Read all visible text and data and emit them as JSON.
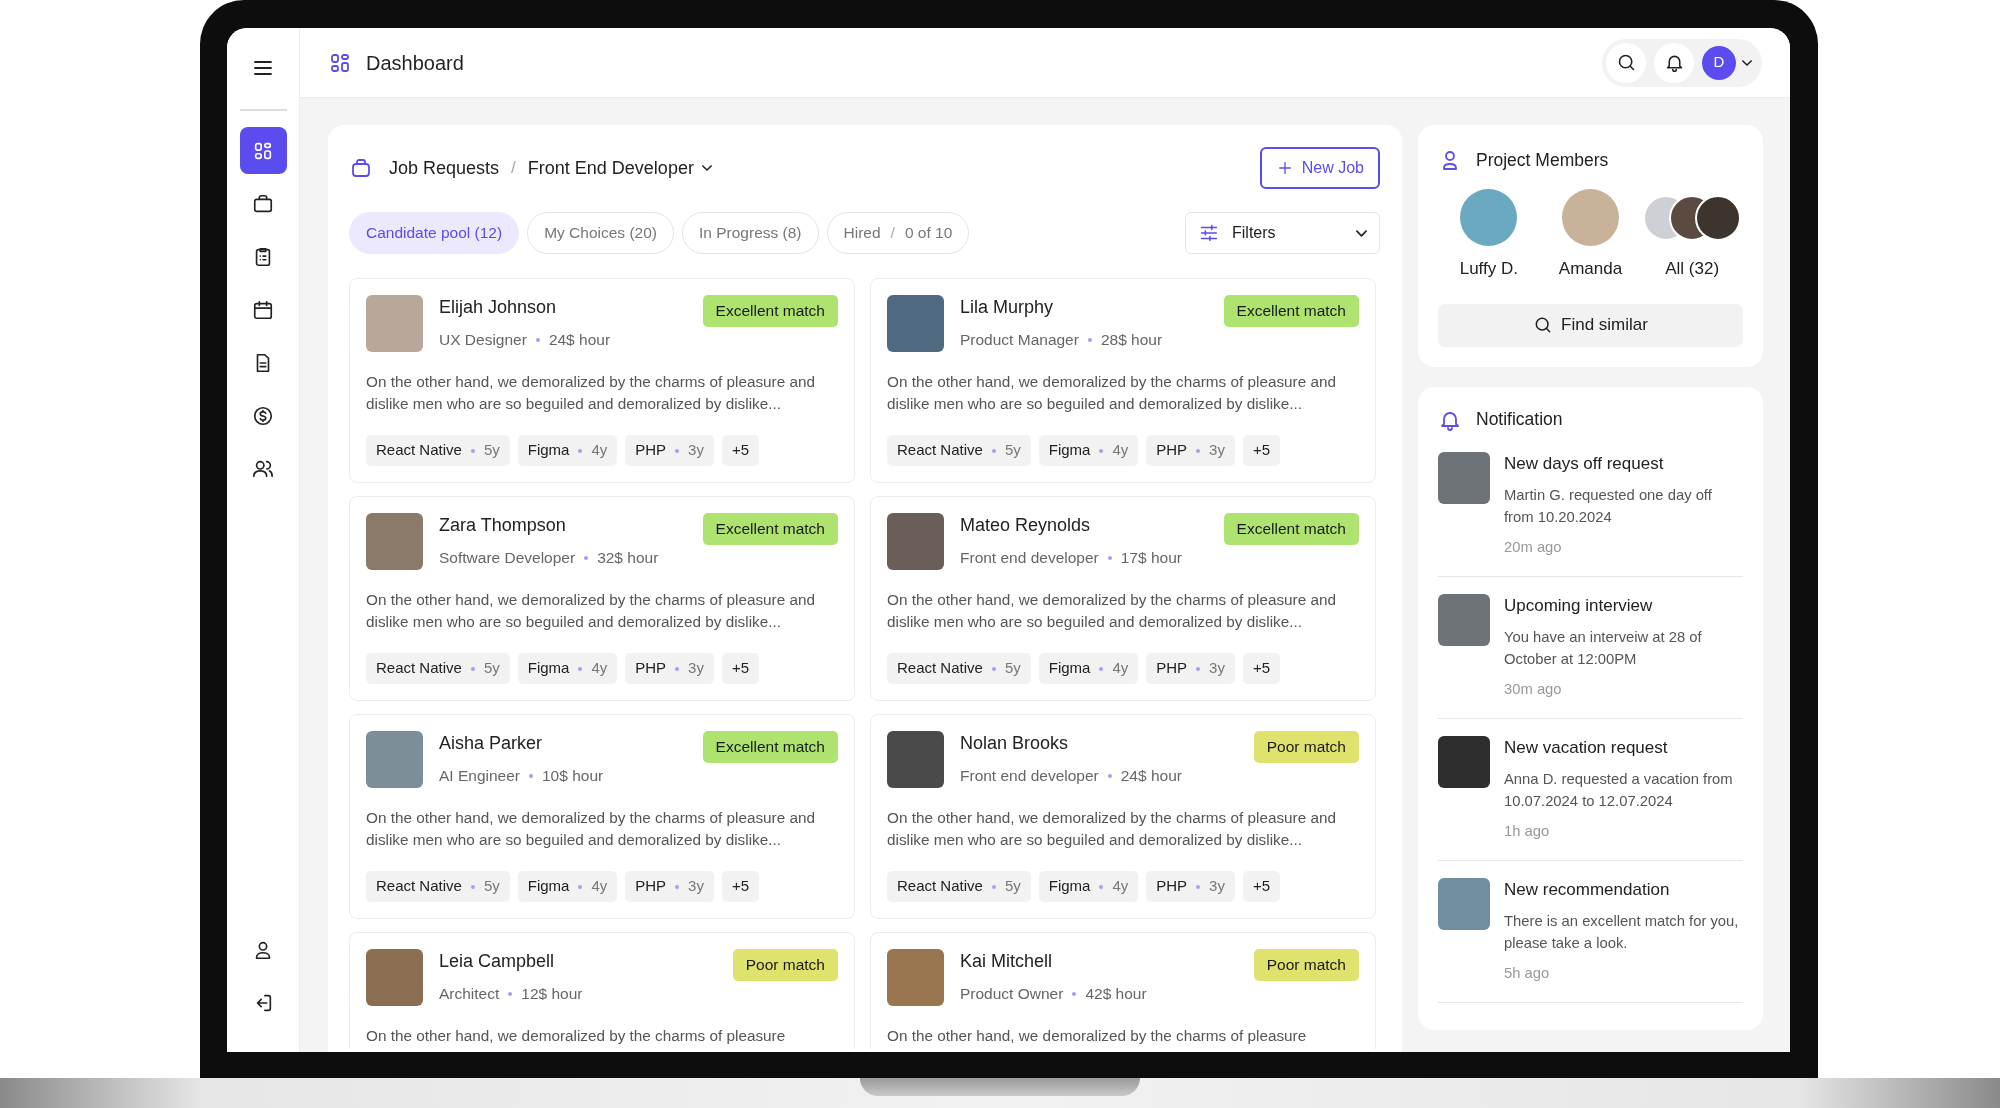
{
  "sidebar": {
    "items": [
      {
        "kind": "grid",
        "selected": true
      },
      {
        "kind": "briefcase",
        "selected": false
      },
      {
        "kind": "clipboard",
        "selected": false
      },
      {
        "kind": "calendar",
        "selected": false
      },
      {
        "kind": "document",
        "selected": false
      },
      {
        "kind": "dollar",
        "selected": false
      },
      {
        "kind": "users",
        "selected": false
      }
    ],
    "bottom_items": [
      {
        "kind": "user",
        "selected": false
      },
      {
        "kind": "logout",
        "selected": false
      }
    ]
  },
  "topbar": {
    "title": "Dashboard",
    "avatar_initial": "D"
  },
  "breadcrumb": {
    "items": [
      "Job Requests",
      "Front End Developer"
    ],
    "separator": "/"
  },
  "new_job_button": "New Job",
  "tabs": [
    {
      "label": "Candidate pool (12)",
      "selected": true
    },
    {
      "label": "My Choices (20)",
      "selected": false
    },
    {
      "label": "In Progress (8)",
      "selected": false
    },
    {
      "label": "Hired",
      "separator": "/",
      "count": "0 of 10",
      "selected": false
    }
  ],
  "filters": {
    "label": "Filters"
  },
  "candidates": [
    {
      "name": "Elijah Johnson",
      "role": "UX Designer",
      "rate": "24$ hour",
      "match": "Excellent match",
      "color": "#aee36f",
      "description": "On the other hand, we demoralized by the charms of pleasure and dislike men who are so beguiled and demoralized by  dislike...",
      "skills": [
        {
          "name": "React Native",
          "years": "5y"
        },
        {
          "name": "Figma",
          "years": "4y"
        },
        {
          "name": "PHP",
          "years": "3y"
        }
      ],
      "more": "+5"
    },
    {
      "name": "Lila Murphy",
      "role": "Product Manager",
      "rate": "28$ hour",
      "match": "Excellent match",
      "color": "#aee36f",
      "description": "On the other hand, we demoralized by the charms of pleasure and dislike men who are so beguiled and demoralized by  dislike...",
      "skills": [
        {
          "name": "React Native",
          "years": "5y"
        },
        {
          "name": "Figma",
          "years": "4y"
        },
        {
          "name": "PHP",
          "years": "3y"
        }
      ],
      "more": "+5"
    },
    {
      "name": "Zara Thompson",
      "role": "Software Developer",
      "rate": "32$ hour",
      "match": "Excellent match",
      "color": "#aee36f",
      "description": "On the other hand, we demoralized by the charms of pleasure and dislike men who are so beguiled and demoralized by  dislike...",
      "skills": [
        {
          "name": "React Native",
          "years": "5y"
        },
        {
          "name": "Figma",
          "years": "4y"
        },
        {
          "name": "PHP",
          "years": "3y"
        }
      ],
      "more": "+5"
    },
    {
      "name": "Mateo Reynolds",
      "role": "Front end developer",
      "rate": "17$ hour",
      "match": "Excellent match",
      "color": "#aee36f",
      "description": "On the other hand, we demoralized by the charms of pleasure and dislike men who are so beguiled and demoralized by  dislike...",
      "skills": [
        {
          "name": "React Native",
          "years": "5y"
        },
        {
          "name": "Figma",
          "years": "4y"
        },
        {
          "name": "PHP",
          "years": "3y"
        }
      ],
      "more": "+5"
    },
    {
      "name": "Aisha Parker",
      "role": "AI Engineer",
      "rate": "10$ hour",
      "match": "Excellent match",
      "color": "#aee36f",
      "description": "On the other hand, we demoralized by the charms of pleasure and dislike men who are so beguiled and demoralized by  dislike...",
      "skills": [
        {
          "name": "React Native",
          "years": "5y"
        },
        {
          "name": "Figma",
          "years": "4y"
        },
        {
          "name": "PHP",
          "years": "3y"
        }
      ],
      "more": "+5"
    },
    {
      "name": "Nolan Brooks",
      "role": "Front end developer",
      "rate": "24$ hour",
      "match": "Poor match",
      "color": "#dfe36e",
      "description": "On the other hand, we demoralized by the charms of pleasure and dislike men who are so beguiled and demoralized by  dislike...",
      "skills": [
        {
          "name": "React Native",
          "years": "5y"
        },
        {
          "name": "Figma",
          "years": "4y"
        },
        {
          "name": "PHP",
          "years": "3y"
        }
      ],
      "more": "+5"
    },
    {
      "name": "Leia Campbell",
      "role": "Architect",
      "rate": "12$ hour",
      "match": "Poor match",
      "color": "#dfe36e",
      "description": "On the other hand, we demoralized by the charms of pleasure"
    },
    {
      "name": "Kai Mitchell",
      "role": "Product Owner",
      "rate": "42$ hour",
      "match": "Poor match",
      "color": "#dfe36e",
      "description": "On the other hand, we demoralized by the charms of pleasure"
    }
  ],
  "members": {
    "title": "Project Members",
    "people": [
      {
        "name": "Luffy D.",
        "kind": "single"
      },
      {
        "name": "Amanda",
        "kind": "single"
      },
      {
        "name": "All (32)",
        "kind": "group"
      }
    ],
    "find_button": "Find similar"
  },
  "notifications": {
    "title": "Notification",
    "items": [
      {
        "title": "New days off request",
        "text": "Martin G. requested one day off from 10.20.2024",
        "time": "20m ago"
      },
      {
        "title": "Upcoming interview",
        "text": "You have an interveiw at 28 of October at 12:00PM",
        "time": "30m ago"
      },
      {
        "title": "New vacation request",
        "text": "Anna D. requested a vacation from 10.07.2024 to 12.07.2024",
        "time": "1h ago"
      },
      {
        "title": "New recommendation",
        "text": "There is an excellent match for you, please take a look.",
        "time": "5h ago"
      }
    ]
  }
}
